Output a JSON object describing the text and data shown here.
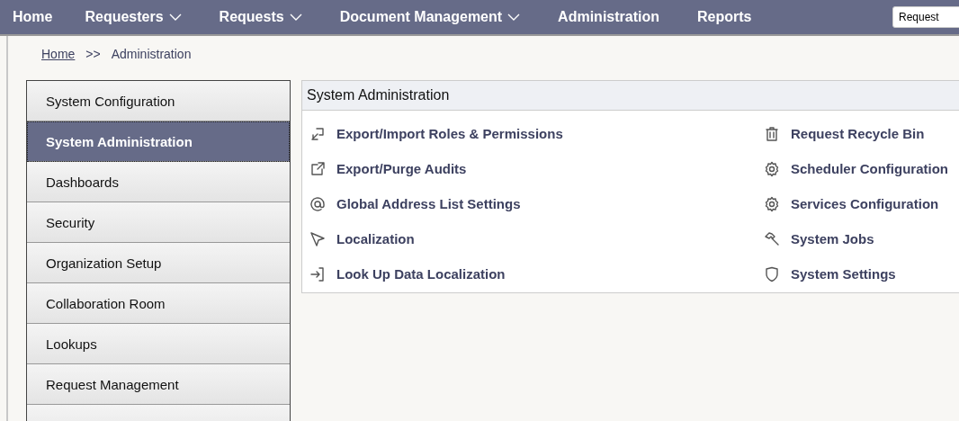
{
  "nav": {
    "items": [
      {
        "label": "Home",
        "dropdown": false
      },
      {
        "label": "Requesters",
        "dropdown": true
      },
      {
        "label": "Requests",
        "dropdown": true
      },
      {
        "label": "Document Management",
        "dropdown": true
      },
      {
        "label": "Administration",
        "dropdown": false
      },
      {
        "label": "Reports",
        "dropdown": false
      }
    ],
    "search": {
      "value": "Request"
    }
  },
  "breadcrumb": {
    "link": "Home",
    "separator": ">>",
    "current": "Administration"
  },
  "sidebar": {
    "items": [
      {
        "label": "System Configuration",
        "selected": false
      },
      {
        "label": "System Administration",
        "selected": true
      },
      {
        "label": "Dashboards",
        "selected": false
      },
      {
        "label": "Security",
        "selected": false
      },
      {
        "label": "Organization Setup",
        "selected": false
      },
      {
        "label": "Collaboration Room",
        "selected": false
      },
      {
        "label": "Lookups",
        "selected": false
      },
      {
        "label": "Request Management",
        "selected": false
      }
    ]
  },
  "panel": {
    "title": "System Administration",
    "columns": [
      [
        {
          "label": "Export/Import Roles & Permissions",
          "kind": "import"
        },
        {
          "label": "Export/Purge Audits",
          "kind": "external"
        },
        {
          "label": "Global Address List Settings",
          "kind": "at"
        },
        {
          "label": "Localization",
          "kind": "pointer"
        },
        {
          "label": "Look Up Data Localization",
          "kind": "login"
        }
      ],
      [
        {
          "label": "Request Recycle Bin",
          "kind": "trash"
        },
        {
          "label": "Scheduler Configuration",
          "kind": "gear"
        },
        {
          "label": "Services Configuration",
          "kind": "gear"
        },
        {
          "label": "System Jobs",
          "kind": "hammer"
        },
        {
          "label": "System Settings",
          "kind": "shield"
        }
      ]
    ]
  }
}
